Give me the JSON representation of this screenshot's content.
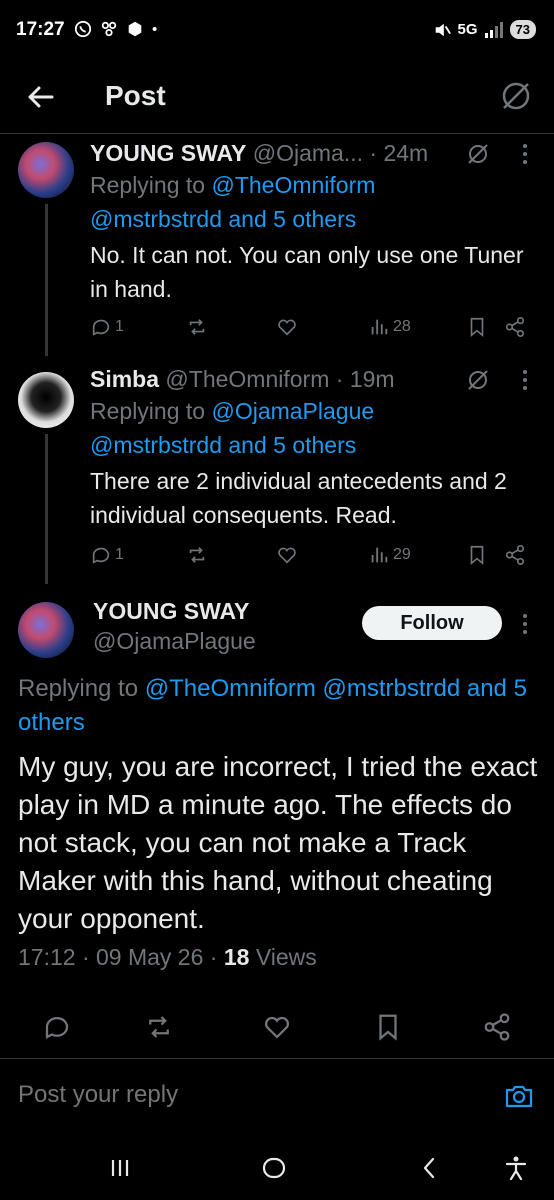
{
  "status_bar": {
    "time": "17:27",
    "network": "5G",
    "battery": "73"
  },
  "header": {
    "title": "Post"
  },
  "replies": [
    {
      "name": "YOUNG SWAY",
      "handle": "@Ojama...",
      "time": "· 24m",
      "replying_prefix": "Replying to ",
      "replying_link1": "@TheOmniform",
      "replying_link2": "@mstrbstrdd and 5 others",
      "text": "No. It can not. You can only use one Tuner in hand.",
      "replies_count": "1",
      "views": "28"
    },
    {
      "name": "Simba",
      "handle": "@TheOmniform",
      "time": "· 19m",
      "replying_prefix": "Replying to ",
      "replying_link1": "@OjamaPlague",
      "replying_link2": "@mstrbstrdd and 5 others",
      "text": "There are 2 individual antecedents and 2 individual consequents. Read.",
      "replies_count": "1",
      "views": "29"
    }
  ],
  "main_post": {
    "name": "YOUNG SWAY",
    "handle": "@OjamaPlague",
    "follow_label": "Follow",
    "replying_prefix": "Replying to ",
    "replying_links": "@TheOmniform @mstrbstrdd and 5 others",
    "text": "My guy, you are incorrect, I tried the exact play in MD a minute ago. The effects do not stack, you can not make a Track Maker with this hand, without cheating your opponent.",
    "timestamp": "17:12 · 09 May 26 · ",
    "views_count": "18",
    "views_label": " Views"
  },
  "reply_bar": {
    "placeholder": "Post your reply"
  },
  "colors": {
    "accent": "#1d9bf0",
    "muted": "#71767b",
    "text": "#e7e9ea",
    "background": "#000000"
  }
}
